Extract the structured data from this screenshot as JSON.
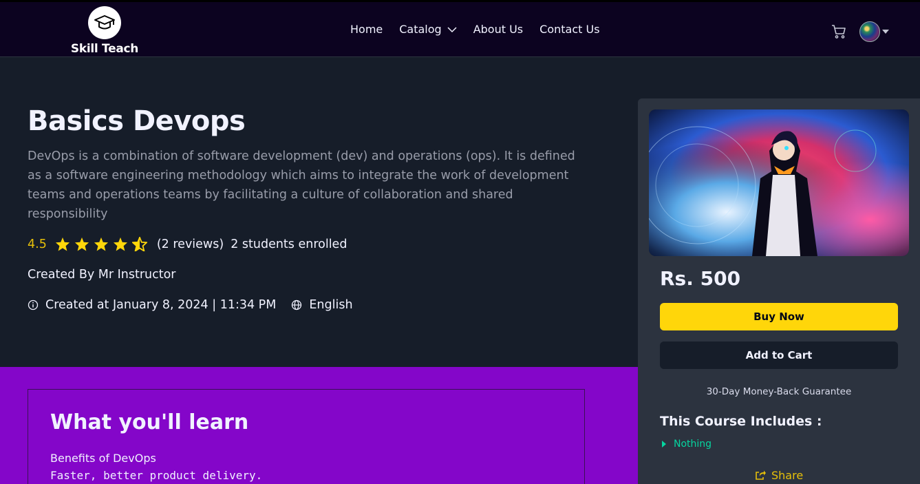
{
  "brand": {
    "name": "Skill Teach"
  },
  "nav": {
    "links": [
      "Home",
      "Catalog",
      "About Us",
      "Contact Us"
    ]
  },
  "course": {
    "title": "Basics Devops",
    "description": "DevOps is a combination of software development (dev) and operations (ops). It is defined as a software engineering methodology which aims to integrate the work of development teams and operations teams by facilitating a culture of collaboration and shared responsibility",
    "rating": "4.5",
    "rating_value": 4.5,
    "rating_max": 5,
    "reviews": "(2 reviews)",
    "enrolled": "2 students enrolled",
    "created_by": "Created By Mr Instructor",
    "created_at": "Created at January 8, 2024 | 11:34 PM",
    "language": "English"
  },
  "learn": {
    "title": "What you'll learn",
    "line1": "Benefits of DevOps",
    "line2": "Faster, better product delivery."
  },
  "card": {
    "price": "Rs. 500",
    "buy_label": "Buy Now",
    "cart_label": "Add to Cart",
    "guarantee": "30-Day Money-Back Guarantee",
    "includes_title": "This Course Includes :",
    "includes_items": [
      "Nothing"
    ],
    "share_label": "Share"
  },
  "colors": {
    "accent_yellow": "#ffd60a",
    "rating_yellow": "#e7c009",
    "purple_section": "#8406c9",
    "includes_green": "#06d6a0"
  }
}
